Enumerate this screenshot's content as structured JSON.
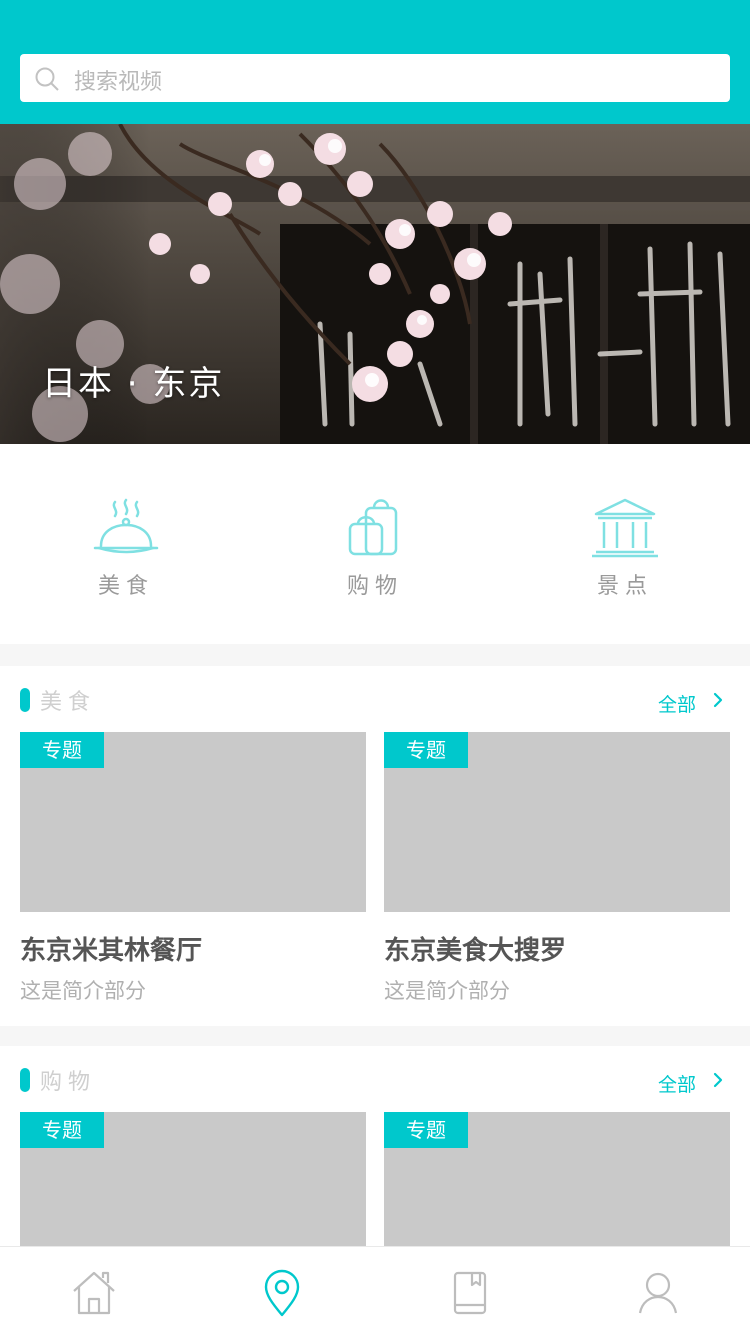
{
  "search": {
    "placeholder": "搜索视频"
  },
  "hero": {
    "city": "日本 · 东京"
  },
  "categories": [
    {
      "label": "美食",
      "icon": "cloche-icon"
    },
    {
      "label": "购物",
      "icon": "shopping-bag-icon"
    },
    {
      "label": "景点",
      "icon": "landmark-icon"
    }
  ],
  "sections": [
    {
      "title": "美食",
      "all_label": "全部",
      "cards": [
        {
          "tag": "专题",
          "title": "东京米其林餐厅",
          "desc": "这是简介部分"
        },
        {
          "tag": "专题",
          "title": "东京美食大搜罗",
          "desc": "这是简介部分"
        }
      ]
    },
    {
      "title": "购物",
      "all_label": "全部",
      "cards": [
        {
          "tag": "专题"
        },
        {
          "tag": "专题"
        }
      ]
    }
  ],
  "tabbar": [
    {
      "icon": "home-icon",
      "active": false
    },
    {
      "icon": "location-pin-icon",
      "active": true
    },
    {
      "icon": "book-icon",
      "active": false
    },
    {
      "icon": "profile-icon",
      "active": false
    }
  ],
  "colors": {
    "accent": "#00c8cc",
    "inactive": "#b9b9b9"
  }
}
